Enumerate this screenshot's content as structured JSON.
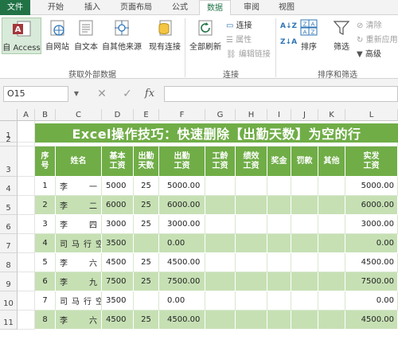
{
  "ribbon_tabs": [
    "文件",
    "开始",
    "插入",
    "页面布局",
    "公式",
    "数据",
    "审阅",
    "视图"
  ],
  "active_tab": "数据",
  "get_external": {
    "access": "自 Access",
    "web": "自网站",
    "text": "自文本",
    "other": "自其他来源",
    "existing": "现有连接",
    "group_label": "获取外部数据"
  },
  "connections": {
    "refresh_all": "全部刷新",
    "connections": "连接",
    "properties": "属性",
    "edit_links": "编辑链接",
    "group_label": "连接"
  },
  "sort_filter": {
    "sort": "排序",
    "filter": "筛选",
    "clear": "清除",
    "reapply": "重新应用",
    "advanced": "高级",
    "group_label": "排序和筛选"
  },
  "formula_bar": {
    "name_box": "O15",
    "cancel_symbol": "✕",
    "enter_symbol": "✓",
    "fx_symbol": "fx"
  },
  "columns": [
    "A",
    "B",
    "C",
    "D",
    "E",
    "F",
    "G",
    "H",
    "I",
    "J",
    "K",
    "L"
  ],
  "rows": [
    "1",
    "2",
    "3",
    "4",
    "5",
    "6",
    "7",
    "8",
    "9",
    "10",
    "11"
  ],
  "sheet_title": "Excel操作技巧：快速删除【出勤天数】为空的行",
  "table_headers": [
    "序号",
    "姓名",
    "基本工资",
    "出勤天数",
    "出勤工资",
    "工龄工资",
    "绩效工资",
    "奖金",
    "罚款",
    "其他",
    "实发工资"
  ],
  "table_rows": [
    [
      "1",
      "李一",
      "5000",
      "25",
      "5000.00",
      "",
      "",
      "",
      "",
      "",
      "5000.00"
    ],
    [
      "2",
      "李二",
      "6000",
      "25",
      "6000.00",
      "",
      "",
      "",
      "",
      "",
      "6000.00"
    ],
    [
      "3",
      "李四",
      "3000",
      "25",
      "3000.00",
      "",
      "",
      "",
      "",
      "",
      "3000.00"
    ],
    [
      "4",
      "司马行空",
      "3500",
      "",
      "0.00",
      "",
      "",
      "",
      "",
      "",
      "0.00"
    ],
    [
      "5",
      "李六",
      "4500",
      "25",
      "4500.00",
      "",
      "",
      "",
      "",
      "",
      "4500.00"
    ],
    [
      "6",
      "李九",
      "7500",
      "25",
      "7500.00",
      "",
      "",
      "",
      "",
      "",
      "7500.00"
    ],
    [
      "7",
      "司马行空",
      "3500",
      "",
      "0.00",
      "",
      "",
      "",
      "",
      "",
      "0.00"
    ],
    [
      "8",
      "李六",
      "4500",
      "25",
      "4500.00",
      "",
      "",
      "",
      "",
      "",
      "4500.00"
    ]
  ],
  "colors": {
    "accent_green": "#70ad47",
    "row_alt_green": "#c6e0b4",
    "row_white": "#ffffff",
    "file_tab": "#217346"
  },
  "icons": [
    "access-icon",
    "web-icon",
    "text-icon",
    "other-sources-icon",
    "existing-connections-icon",
    "refresh-icon",
    "connections-icon",
    "properties-icon",
    "edit-links-icon",
    "sort-az-icon",
    "sort-za-icon",
    "sort-icon",
    "filter-icon",
    "clear-icon",
    "reapply-icon",
    "advanced-icon"
  ]
}
